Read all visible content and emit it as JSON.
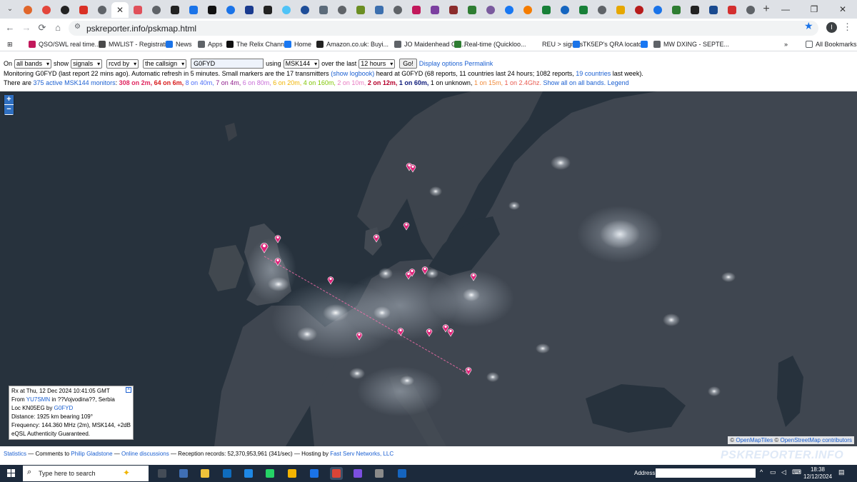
{
  "browser": {
    "tabs": [
      {
        "color": "#e0662b",
        "shape": "round"
      },
      {
        "color": "#e3463b",
        "shape": "round"
      },
      {
        "color": "#232323",
        "shape": "round"
      },
      {
        "color": "#d93025",
        "shape": "square"
      },
      {
        "color": "#5f6368",
        "shape": "round"
      },
      {
        "color": "#5f6368",
        "shape": "round",
        "active": true
      },
      {
        "color": "#e0505a",
        "shape": "square"
      },
      {
        "color": "#5f6368",
        "shape": "round"
      },
      {
        "color": "#222222",
        "shape": "square"
      },
      {
        "color": "#1a73e8",
        "shape": "square"
      },
      {
        "color": "#111111",
        "shape": "square"
      },
      {
        "color": "#1a73e8",
        "shape": "round"
      },
      {
        "color": "#1a3b8f",
        "shape": "square"
      },
      {
        "color": "#222222",
        "shape": "square"
      },
      {
        "color": "#4fc3f7",
        "shape": "round"
      },
      {
        "color": "#1f4e99",
        "shape": "round"
      },
      {
        "color": "#5c6b7a",
        "shape": "square"
      },
      {
        "color": "#5f6368",
        "shape": "round"
      },
      {
        "color": "#6b8e23",
        "shape": "square"
      },
      {
        "color": "#3c6fae",
        "shape": "square"
      },
      {
        "color": "#5f6368",
        "shape": "round"
      },
      {
        "color": "#c2185b",
        "shape": "square"
      },
      {
        "color": "#7b3fa0",
        "shape": "square"
      },
      {
        "color": "#8b2c2c",
        "shape": "square"
      },
      {
        "color": "#2e7d32",
        "shape": "square"
      },
      {
        "color": "#7a5a9e",
        "shape": "round"
      },
      {
        "color": "#1877f2",
        "shape": "round"
      },
      {
        "color": "#f57c00",
        "shape": "round"
      },
      {
        "color": "#188038",
        "shape": "square"
      },
      {
        "color": "#1565c0",
        "shape": "round"
      },
      {
        "color": "#188038",
        "shape": "square"
      },
      {
        "color": "#5f6368",
        "shape": "round"
      },
      {
        "color": "#e6a700",
        "shape": "square"
      },
      {
        "color": "#b71c1c",
        "shape": "round"
      },
      {
        "color": "#1a73e8",
        "shape": "round"
      },
      {
        "color": "#2e7d32",
        "shape": "square"
      },
      {
        "color": "#222222",
        "shape": "square"
      },
      {
        "color": "#1a4a8f",
        "shape": "square"
      },
      {
        "color": "#d32f2f",
        "shape": "square"
      },
      {
        "color": "#5f6368",
        "shape": "round"
      }
    ],
    "new_tab_label": "+",
    "url": "pskreporter.info/pskmap.html",
    "profile_initial": "I",
    "bookmarks": [
      {
        "label": "QSO/SWL real time...",
        "color": "#c2185b"
      },
      {
        "label": "MWLIST - Registrati...",
        "color": "#4a4a4a"
      },
      {
        "label": "News",
        "color": "#1a73e8"
      },
      {
        "label": "Apps",
        "color": "#5f6368"
      },
      {
        "label": "The Relix Channel",
        "color": "#111111"
      },
      {
        "label": "Home",
        "color": "#1877f2"
      },
      {
        "label": "Amazon.co.uk: Buyi...",
        "color": "#222222"
      },
      {
        "label": "JO Maidenhead Gri...",
        "color": "#5f6368"
      },
      {
        "label": "Real-time (Quickloo...",
        "color": "#2e7d32"
      },
      {
        "label": "REU > signals",
        "color": "#ffffff"
      },
      {
        "label": "TK5EP's QRA locato...",
        "color": "#1a73e8"
      },
      {
        "label": "",
        "color": "#1877f2"
      },
      {
        "label": "MW DXING - SEPTE...",
        "color": "#5f6368"
      }
    ],
    "all_bookmarks": "All Bookmarks"
  },
  "controls": {
    "on_label": "On",
    "band_value": "all bands",
    "show_label": "show",
    "show_value": "signals",
    "rcvd_value": "rcvd by",
    "callsign_mode": "the callsign",
    "callsign_input": "G0FYD",
    "using_label": "using",
    "mode_value": "MSK144",
    "over_label": "over the last",
    "period_value": "12 hours",
    "go_label": "Go!",
    "display_options": "Display options",
    "permalink": "Permalink"
  },
  "status": {
    "monitoring_text": "Monitoring G0FYD (last report 22 mins ago). Automatic refresh in 5 minutes. Small markers are the 17 transmitters",
    "show_logbook": "(show logbook)",
    "heard_text": "heard at G0FYD (68 reports, 11 countries last 24 hours; 1082 reports,",
    "countries_link": "19 countries",
    "last_week": "last week).",
    "there_are": "There are",
    "active_monitors": "375 active MSK144 monitors",
    "bands": [
      {
        "label": "308 on 2m",
        "color": "#e0245e"
      },
      {
        "label": "64 on 6m",
        "color": "#d81b1b"
      },
      {
        "label": "8 on 40m",
        "color": "#4a6cf7"
      },
      {
        "label": "7 on 4m",
        "color": "#8e1a8a"
      },
      {
        "label": "6 on 80m",
        "color": "#c86dd7"
      },
      {
        "label": "6 on 20m",
        "color": "#f0b400"
      },
      {
        "label": "4 on 160m",
        "color": "#7fc500"
      },
      {
        "label": "2 on 10m",
        "color": "#e879c0"
      },
      {
        "label": "2 on 12m",
        "color": "#b5002b"
      },
      {
        "label": "1 on 60m",
        "color": "#0d1a7a"
      },
      {
        "label": "1 on unknown",
        "color": "#000000"
      },
      {
        "label": "1 on 15m",
        "color": "#f08a3a"
      },
      {
        "label": "1 on 2.4Ghz",
        "color": "#e85a4f"
      }
    ],
    "show_all": "Show all on all bands.",
    "legend": "Legend"
  },
  "map": {
    "zoom_in": "+",
    "zoom_out": "−",
    "popup": {
      "close": "×",
      "rx_line": "Rx at Thu, 12 Dec 2024 10:41:05 GMT",
      "from_prefix": "From",
      "from_call": "YU7SMN",
      "from_suffix": "in ??Vojvodina??, Serbia",
      "loc_prefix": "Loc KN05EG by",
      "loc_call": "G0FYD",
      "distance": "Distance: 1925 km bearing 109°",
      "frequency": "Frequency: 144.360 MHz (2m), MSK144, +2dB",
      "eqsl": "eQSL Authenticity Guaranteed."
    },
    "attribution_prefix": "©",
    "attribution_tiles": "OpenMapTiles",
    "attribution_mid": "©",
    "attribution_osm": "OpenStreetMap contributors",
    "marker_color": "#e0247a",
    "path_color": "#ff6fb0"
  },
  "footer": {
    "statistics": "Statistics",
    "comments": "— Comments to",
    "author": "Philip Gladstone",
    "dash": "—",
    "discussions": "Online discussions",
    "records": "— Reception records: 52,370,953,961 (341/sec) — Hosting by",
    "host": "Fast Serv Networks, LLC",
    "brand": "PSKREPORTER.INFO"
  },
  "taskbar": {
    "search_placeholder": "Type here to search",
    "address_label": "Address",
    "time": "18:38",
    "date": "12/12/2024",
    "apps": [
      {
        "color": "#444c57"
      },
      {
        "color": "#3f6fb5"
      },
      {
        "color": "#f0c23a"
      },
      {
        "color": "#0f6cbd"
      },
      {
        "color": "#1e88e5"
      },
      {
        "color": "#25d366"
      },
      {
        "color": "#f4b400"
      },
      {
        "color": "#1a73e8"
      },
      {
        "color": "#db4437",
        "active": true
      },
      {
        "color": "#7b4fe0"
      },
      {
        "color": "#8a8a8a"
      },
      {
        "color": "#1565c0"
      }
    ]
  }
}
